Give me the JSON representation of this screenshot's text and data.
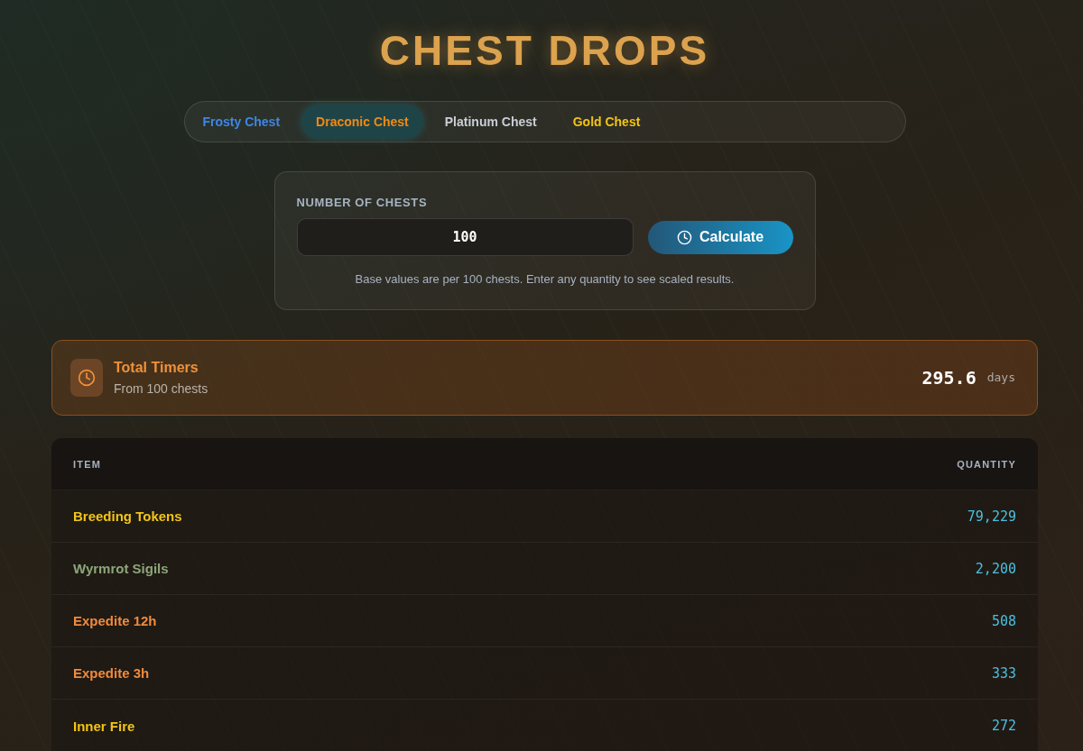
{
  "title": "CHEST DROPS",
  "tabs": [
    {
      "label": "Frosty Chest",
      "color": "#3f86e6",
      "selected": false
    },
    {
      "label": "Draconic Chest",
      "color": "#f28a12",
      "selected": true
    },
    {
      "label": "Platinum Chest",
      "color": "#c9ced6",
      "selected": false
    },
    {
      "label": "Gold Chest",
      "color": "#f2c418",
      "selected": false
    }
  ],
  "calculator": {
    "label": "NUMBER OF CHESTS",
    "value": "100",
    "button": "Calculate",
    "note": "Base values are per 100 chests. Enter any quantity to see scaled results."
  },
  "total_timers": {
    "title": "Total Timers",
    "subtitle": "From 100 chests",
    "value": "295.6",
    "unit": "days"
  },
  "table": {
    "columns": [
      "ITEM",
      "QUANTITY"
    ],
    "rows": [
      {
        "item": "Breeding Tokens",
        "color": "#f2c418",
        "quantity": "79,229"
      },
      {
        "item": "Wyrmrot Sigils",
        "color": "#8ea67a",
        "quantity": "2,200"
      },
      {
        "item": "Expedite 12h",
        "color": "#f08a3c",
        "quantity": "508"
      },
      {
        "item": "Expedite 3h",
        "color": "#f08a3c",
        "quantity": "333"
      },
      {
        "item": "Inner Fire",
        "color": "#f2c418",
        "quantity": "272"
      }
    ]
  }
}
